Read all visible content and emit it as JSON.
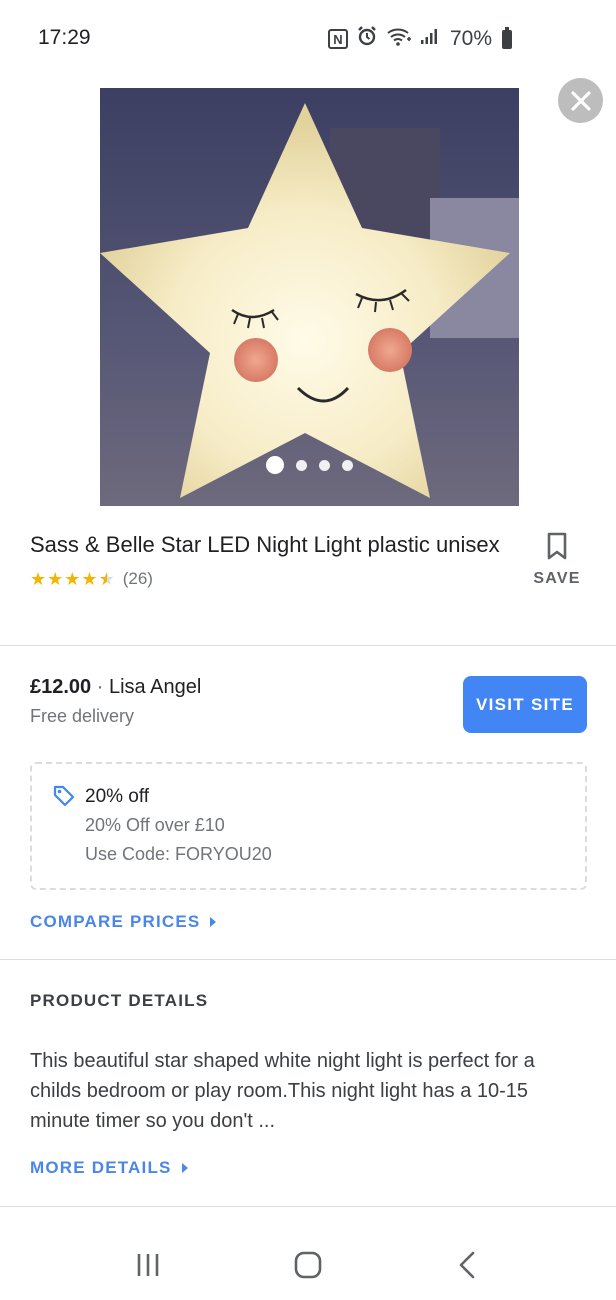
{
  "status_bar": {
    "time": "17:29",
    "nfc_label": "N",
    "battery_percent": "70%"
  },
  "gallery": {
    "image_count": 4,
    "active_index": 0,
    "close_icon": "close-icon"
  },
  "product": {
    "title": "Sass & Belle Star LED Night Light plastic unisex",
    "rating": 4.5,
    "review_count": "(26)",
    "save_label": "SAVE"
  },
  "offer_summary": {
    "price": "£12.00",
    "separator": "·",
    "seller": "Lisa Angel",
    "delivery": "Free delivery",
    "visit_label": "VISIT SITE"
  },
  "promo": {
    "title": "20% off",
    "detail": "20% Off over £10",
    "code_line": "Use Code: FORYOU20"
  },
  "links": {
    "compare_prices": "COMPARE PRICES",
    "more_details": "MORE DETAILS"
  },
  "details": {
    "heading": "PRODUCT DETAILS",
    "description": "This beautiful star shaped white night light is perfect for a childs bedroom or play room.This night light has a 10-15 minute timer so you don't ..."
  },
  "nav": {
    "recents_icon": "recents-icon",
    "home_icon": "home-icon",
    "back_icon": "back-icon"
  },
  "colors": {
    "accent_blue": "#4285f4",
    "link_blue": "#4a86e8",
    "star_gold": "#f5b400"
  }
}
